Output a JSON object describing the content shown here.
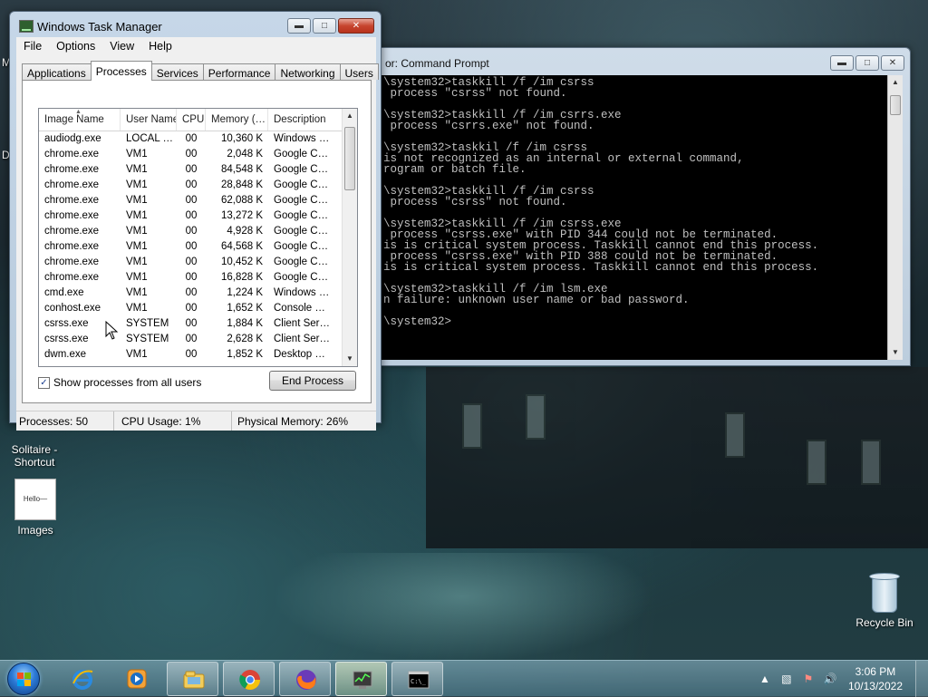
{
  "desktop": {
    "icons": [
      {
        "label": "Solitaire -\nShortcut"
      },
      {
        "label": "Images",
        "thumb_text": "Hello—"
      },
      {
        "label": "Recycle Bin"
      }
    ],
    "edge_letters": [
      "M",
      "D"
    ]
  },
  "cmd": {
    "title": "or: Command Prompt",
    "lines": [
      "\\system32>taskkill /f /im csrss",
      " process \"csrss\" not found.",
      "",
      "\\system32>taskkill /f /im csrrs.exe",
      " process \"csrrs.exe\" not found.",
      "",
      "\\system32>taskkil /f /im csrss",
      "is not recognized as an internal or external command,",
      "rogram or batch file.",
      "",
      "\\system32>taskkill /f /im csrss",
      " process \"csrss\" not found.",
      "",
      "\\system32>taskkill /f /im csrss.exe",
      " process \"csrss.exe\" with PID 344 could not be terminated.",
      "is is critical system process. Taskkill cannot end this process.",
      " process \"csrss.exe\" with PID 388 could not be terminated.",
      "is is critical system process. Taskkill cannot end this process.",
      "",
      "\\system32>taskkill /f /im lsm.exe",
      "n failure: unknown user name or bad password.",
      "",
      "\\system32>"
    ]
  },
  "taskmgr": {
    "title": "Windows Task Manager",
    "menu": [
      "File",
      "Options",
      "View",
      "Help"
    ],
    "tabs": [
      "Applications",
      "Processes",
      "Services",
      "Performance",
      "Networking",
      "Users"
    ],
    "active_tab": "Processes",
    "columns": [
      "Image Name",
      "User Name",
      "CPU",
      "Memory (…",
      "Description"
    ],
    "rows": [
      [
        "audiodg.exe",
        "LOCAL …",
        "00",
        "10,360 K",
        "Windows …"
      ],
      [
        "chrome.exe",
        "VM1",
        "00",
        "2,048 K",
        "Google C…"
      ],
      [
        "chrome.exe",
        "VM1",
        "00",
        "84,548 K",
        "Google C…"
      ],
      [
        "chrome.exe",
        "VM1",
        "00",
        "28,848 K",
        "Google C…"
      ],
      [
        "chrome.exe",
        "VM1",
        "00",
        "62,088 K",
        "Google C…"
      ],
      [
        "chrome.exe",
        "VM1",
        "00",
        "13,272 K",
        "Google C…"
      ],
      [
        "chrome.exe",
        "VM1",
        "00",
        "4,928 K",
        "Google C…"
      ],
      [
        "chrome.exe",
        "VM1",
        "00",
        "64,568 K",
        "Google C…"
      ],
      [
        "chrome.exe",
        "VM1",
        "00",
        "10,452 K",
        "Google C…"
      ],
      [
        "chrome.exe",
        "VM1",
        "00",
        "16,828 K",
        "Google C…"
      ],
      [
        "cmd.exe",
        "VM1",
        "00",
        "1,224 K",
        "Windows …"
      ],
      [
        "conhost.exe",
        "VM1",
        "00",
        "1,652 K",
        "Console …"
      ],
      [
        "csrss.exe",
        "SYSTEM",
        "00",
        "1,884 K",
        "Client Ser…"
      ],
      [
        "csrss.exe",
        "SYSTEM",
        "00",
        "2,628 K",
        "Client Ser…"
      ],
      [
        "dwm.exe",
        "VM1",
        "00",
        "1,852 K",
        "Desktop …"
      ]
    ],
    "show_all_label": "Show processes from all users",
    "show_all_checked": true,
    "end_process_label": "End Process",
    "status": {
      "processes": "Processes: 50",
      "cpu": "CPU Usage: 1%",
      "memory": "Physical Memory: 26%"
    }
  },
  "taskbar": {
    "pinned": [
      "start-orb",
      "internet-explorer-icon",
      "media-player-icon",
      "explorer-icon",
      "chrome-icon",
      "firefox-icon",
      "task-manager-icon",
      "command-prompt-icon"
    ],
    "clock_time": "3:06 PM",
    "clock_date": "10/13/2022"
  },
  "colors": {
    "cmd_bg": "#000000",
    "cmd_text": "#c0c0c0",
    "close_red": "#c7452f",
    "title_glass": "#c6d7e8"
  }
}
